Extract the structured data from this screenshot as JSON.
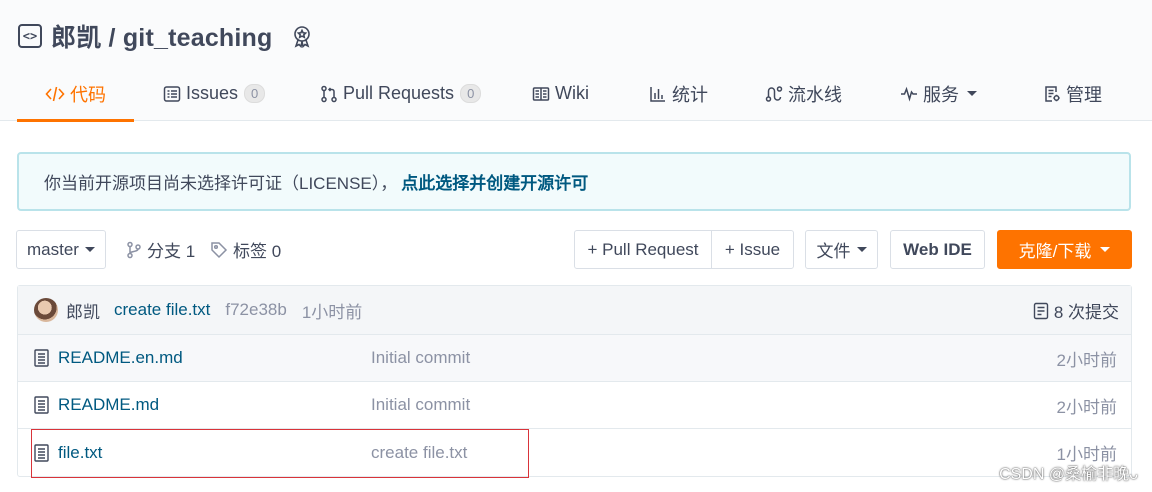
{
  "repo": {
    "title": "郎凯 / git_teaching"
  },
  "tabs": [
    {
      "label": "代码",
      "icon": "code-icon",
      "active": true
    },
    {
      "label": "Issues",
      "count": "0",
      "icon": "issues-icon"
    },
    {
      "label": "Pull Requests",
      "count": "0",
      "icon": "pull-request-icon"
    },
    {
      "label": "Wiki",
      "icon": "book-icon"
    },
    {
      "label": "统计",
      "icon": "bar-chart-icon"
    },
    {
      "label": "流水线",
      "icon": "pipeline-icon"
    },
    {
      "label": "服务",
      "icon": "pulse-icon",
      "dropdown": true
    },
    {
      "label": "管理",
      "icon": "settings-doc-icon"
    }
  ],
  "notice": {
    "text": "你当前开源项目尚未选择许可证（LICENSE），",
    "link": "点此选择并创建开源许可"
  },
  "toolbar": {
    "branch": "master",
    "branches": "分支 1",
    "tags": "标签 0",
    "pull_request": "+ Pull Request",
    "issue": "+ Issue",
    "file": "文件",
    "web_ide": "Web IDE",
    "clone": "克隆/下载"
  },
  "commit": {
    "author": "郎凯",
    "message": "create file.txt",
    "hash": "f72e38b",
    "time": "1小时前",
    "count": "8 次提交"
  },
  "files": [
    {
      "name": "README.en.md",
      "commit": "Initial commit",
      "time": "2小时前"
    },
    {
      "name": "README.md",
      "commit": "Initial commit",
      "time": "2小时前"
    },
    {
      "name": "file.txt",
      "commit": "create file.txt",
      "time": "1小时前"
    }
  ],
  "watermark": "CSDN @桑榆非晚ᴗ",
  "colors": {
    "accent": "#fe7300",
    "link": "#005980",
    "highlight": "#d9343a"
  }
}
